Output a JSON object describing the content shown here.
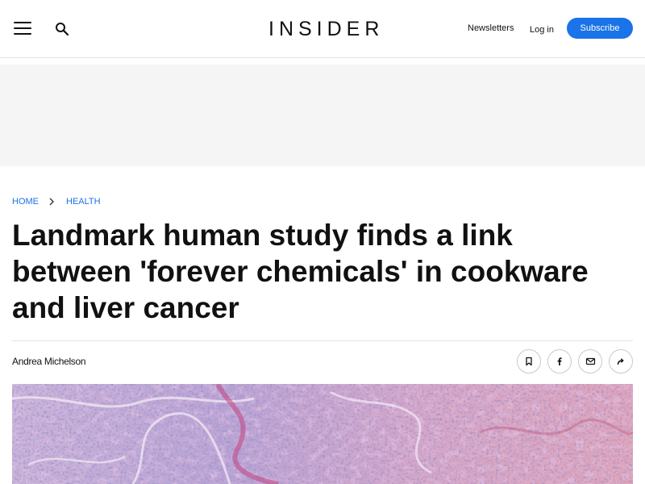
{
  "header": {
    "logo_text": "INSIDER",
    "menu_icon": "hamburger-menu-icon",
    "search_icon": "search-icon",
    "newsletters_label": "Newsletters",
    "login_label": "Log in",
    "subscribe_label": "Subscribe",
    "accent_color": "#1a73e8"
  },
  "breadcrumb": {
    "items": [
      "HOME",
      "HEALTH"
    ],
    "separator_icon": "chevron-right-icon"
  },
  "article": {
    "headline": "Landmark human study finds a link between 'forever chemicals' in cookware and liver cancer",
    "author": "Andrea Michelson"
  },
  "share": {
    "icons": [
      "bookmark-icon",
      "facebook-icon",
      "email-icon",
      "share-arrow-icon"
    ]
  }
}
